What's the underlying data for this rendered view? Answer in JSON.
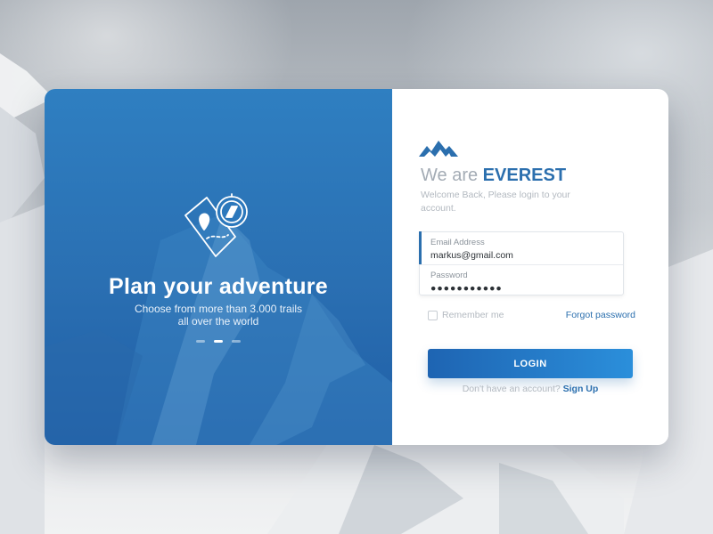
{
  "hero": {
    "title": "Plan your adventure",
    "subtitle_line1": "Choose from more than 3.000 trails",
    "subtitle_line2": "all over the world",
    "slides": [
      {
        "active": false
      },
      {
        "active": true
      },
      {
        "active": false
      }
    ]
  },
  "brand": {
    "prefix": "We are ",
    "name": "EVEREST",
    "welcome": "Welcome Back, Please login to your account."
  },
  "form": {
    "email_label": "Email Address",
    "email_value": "markus@gmail.com",
    "password_label": "Password",
    "password_value": "●●●●●●●●●●●",
    "remember_label": "Remember me",
    "forgot_label": "Forgot password",
    "login_label": "LOGIN",
    "signup_prompt": "Don't have an account?",
    "signup_link": "Sign Up"
  },
  "colors": {
    "accent": "#2b6fae",
    "panel_blue": "#2a6fb2",
    "button_start": "#1e64b2",
    "button_end": "#2b8fdb"
  },
  "icons": {
    "logo": "mountain-logo-icon",
    "hero": "map-compass-icon"
  }
}
